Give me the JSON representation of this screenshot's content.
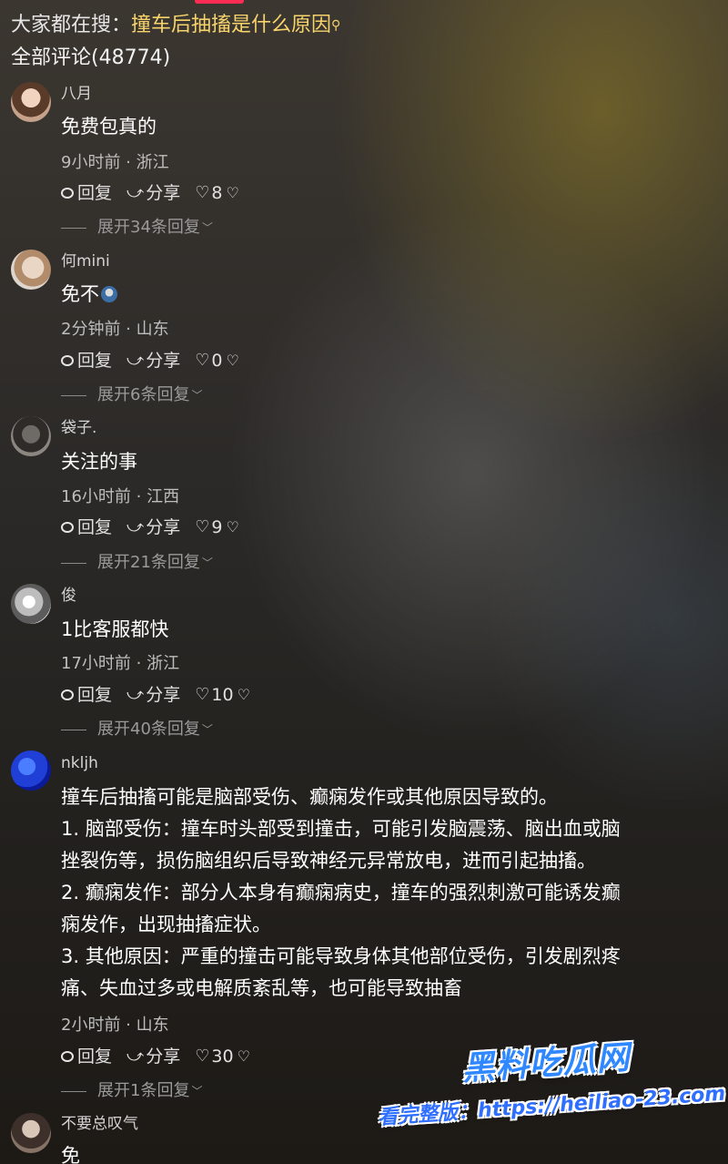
{
  "header": {
    "search_prefix": "大家都在搜：",
    "search_query": "撞车后抽搐是什么原因",
    "comments_title": "全部评论(48774)"
  },
  "comments": [
    {
      "username": "八月",
      "content": "免费包真的",
      "meta": "9小时前 · 浙江",
      "reply_label": "回复",
      "share_label": "分享",
      "likes": "8",
      "expand": "展开34条回复"
    },
    {
      "username": "何mini",
      "content": "免不",
      "meta": "2分钟前 · 山东",
      "reply_label": "回复",
      "share_label": "分享",
      "likes": "0",
      "expand": "展开6条回复"
    },
    {
      "username": "袋子.",
      "content": "关注的事",
      "meta": "16小时前 · 江西",
      "reply_label": "回复",
      "share_label": "分享",
      "likes": "9",
      "expand": "展开21条回复"
    },
    {
      "username": "俊",
      "content": "1比客服都快",
      "meta": "17小时前 · 浙江",
      "reply_label": "回复",
      "share_label": "分享",
      "likes": "10",
      "expand": "展开40条回复"
    },
    {
      "username": "nkljh",
      "content_lines": [
        "撞车后抽搐可能是脑部受伤、癫痫发作或其他原因导致的。",
        "1. 脑部受伤：撞车时头部受到撞击，可能引发脑震荡、脑出血或脑",
        "挫裂伤等，损伤脑组织后导致神经元异常放电，进而引起抽搐。",
        "2. 癫痫发作：部分人本身有癫痫病史，撞车的强烈刺激可能诱发癫",
        "痫发作，出现抽搐症状。",
        "3. 其他原因：严重的撞击可能导致身体其他部位受伤，引发剧烈疼",
        "痛、失血过多或电解质紊乱等，也可能导致抽畜"
      ],
      "meta": "2小时前 · 山东",
      "reply_label": "回复",
      "share_label": "分享",
      "likes": "30",
      "expand": "展开1条回复"
    },
    {
      "username": "不要总叹气",
      "content": "免"
    }
  ],
  "watermark": {
    "brand": "黑料吃瓜网",
    "url_line": "看完整版：https://heiliao-23.com"
  },
  "colors": {
    "search_query": "#f7d36b",
    "accent": "#fe2c55",
    "watermark_blue": "#2f88ff"
  },
  "icons": {
    "search": "search-icon",
    "reply": "reply-icon",
    "share": "share-icon",
    "like": "heart-icon",
    "dislike": "dislike-icon",
    "expand": "chevron-down-icon"
  }
}
